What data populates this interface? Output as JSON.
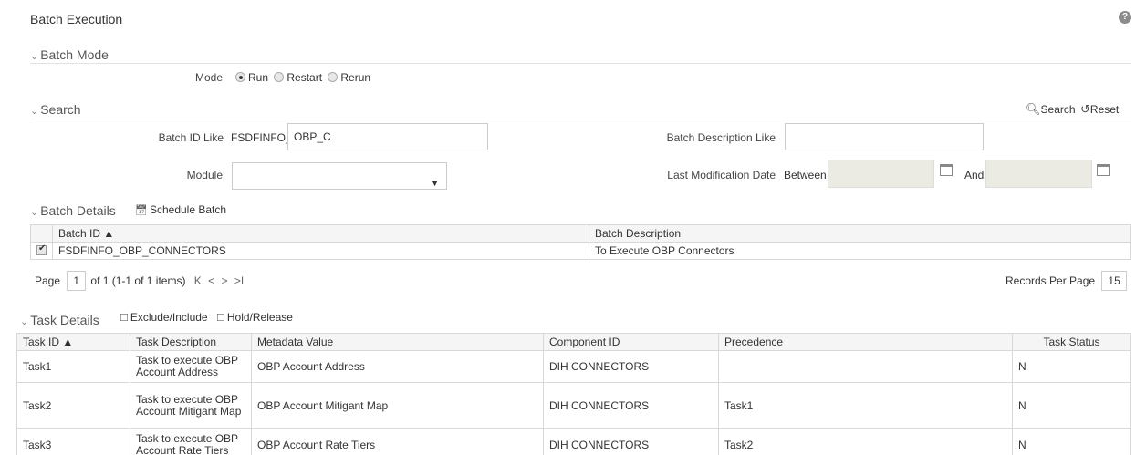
{
  "header": {
    "title": "Batch Execution",
    "help_icon": "help-icon",
    "help_glyph": "?"
  },
  "batch_mode": {
    "section_label": "Batch Mode",
    "mode_label": "Mode",
    "options": [
      {
        "label": "Run",
        "selected": true
      },
      {
        "label": "Restart",
        "selected": false
      },
      {
        "label": "Rerun",
        "selected": false
      }
    ]
  },
  "search": {
    "section_label": "Search",
    "search_button": "Search",
    "reset_button": "Reset",
    "batch_id_label": "Batch ID Like",
    "batch_id_prefix": "FSDFINFO_",
    "batch_id_value": "OBP_C",
    "batch_desc_label": "Batch Description Like",
    "batch_desc_value": "",
    "module_label": "Module",
    "module_value": "",
    "last_mod_label": "Last Modification Date",
    "between_label": "Between",
    "and_label": "And",
    "from_value": "",
    "to_value": ""
  },
  "batch_details": {
    "section_label": "Batch Details",
    "schedule_button": "Schedule Batch",
    "columns": [
      "Batch ID ▲",
      "Batch Description"
    ],
    "rows": [
      {
        "checked": true,
        "batch_id": "FSDFINFO_OBP_CONNECTORS",
        "description": "To Execute OBP Connectors"
      }
    ],
    "pager": {
      "page_label": "Page",
      "page_value": "1",
      "page_info": "of 1 (1-1 of 1 items)",
      "records_label": "Records Per Page",
      "records_value": "15",
      "nav_first": "K",
      "nav_prev": "<",
      "nav_next": ">",
      "nav_last": ">I"
    }
  },
  "task_details": {
    "section_label": "Task Details",
    "exclude_button": "Exclude/Include",
    "hold_button": "Hold/Release",
    "columns": [
      "Task ID ▲",
      "Task Description",
      "Metadata Value",
      "Component ID",
      "Precedence",
      "Task Status"
    ],
    "rows": [
      {
        "id": "Task1",
        "desc": "Task to execute OBP Account Address",
        "meta": "OBP Account Address",
        "component": "DIH CONNECTORS",
        "precedence": "",
        "status": "N"
      },
      {
        "id": "Task2",
        "desc": "Task to execute OBP Account Mitigant Map",
        "meta": "OBP Account Mitigant Map",
        "component": "DIH CONNECTORS",
        "precedence": "Task1",
        "status": "N"
      },
      {
        "id": "Task3",
        "desc": "Task to execute OBP Account Rate Tiers",
        "meta": "OBP Account Rate Tiers",
        "component": "DIH CONNECTORS",
        "precedence": "Task2",
        "status": "N"
      }
    ]
  }
}
